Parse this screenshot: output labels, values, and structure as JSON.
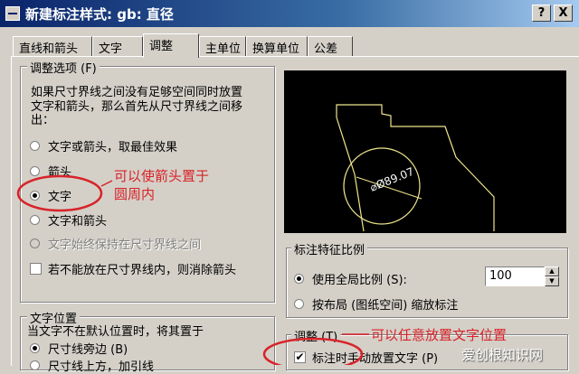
{
  "window": {
    "title": "新建标注样式: gb: 直径",
    "help_button": "?",
    "close_button": "X"
  },
  "tabs": [
    "直线和箭头",
    "文字",
    "调整",
    "主单位",
    "换算单位",
    "公差"
  ],
  "active_tab_index": 2,
  "adjust_options": {
    "legend": "调整选项 (F)",
    "description_line1": "如果尺寸界线之间没有足够空间同时放置",
    "description_line2": "文字和箭头，那么首先从尺寸界线之间移",
    "description_line3": "出：",
    "radios": [
      {
        "label": "文字或箭头，取最佳效果",
        "selected": false,
        "disabled": false
      },
      {
        "label": "箭头",
        "selected": false,
        "disabled": false
      },
      {
        "label": "文字",
        "selected": true,
        "disabled": false
      },
      {
        "label": "文字和箭头",
        "selected": false,
        "disabled": false
      },
      {
        "label": "文字始终保持在尺寸界线之间",
        "selected": false,
        "disabled": true
      }
    ],
    "suppress_checkbox": {
      "label": "若不能放在尺寸界线内，则消除箭头",
      "checked": false
    }
  },
  "text_position": {
    "legend": "文字位置",
    "description": "当文字不在默认位置时，将其置于",
    "radios": [
      {
        "label": "尺寸线旁边 (B)",
        "selected": true
      },
      {
        "label": "尺寸线上方，加引线",
        "selected": false
      }
    ]
  },
  "preview": {
    "dimension_text": "⌀Ø89.07",
    "line_color": "#f0e68c"
  },
  "scale": {
    "legend": "标注特征比例",
    "use_overall_label": "使用全局比例 (S):",
    "use_overall_selected": true,
    "overall_value": "100",
    "layout_label": "按布局 (图纸空间) 缩放标注",
    "layout_selected": false
  },
  "fine_tuning": {
    "legend": "调整 (T)",
    "manual_checkbox": {
      "label": "标注时手动放置文字 (P)",
      "checked": true,
      "mark": "✔"
    }
  },
  "annotations": {
    "arrow_note_line1": "可以使箭头置于",
    "arrow_note_line2": "圆周内",
    "manual_note": "可以任意放置文字位置",
    "color": "#d8232a"
  },
  "watermark": "爱创根知识网"
}
